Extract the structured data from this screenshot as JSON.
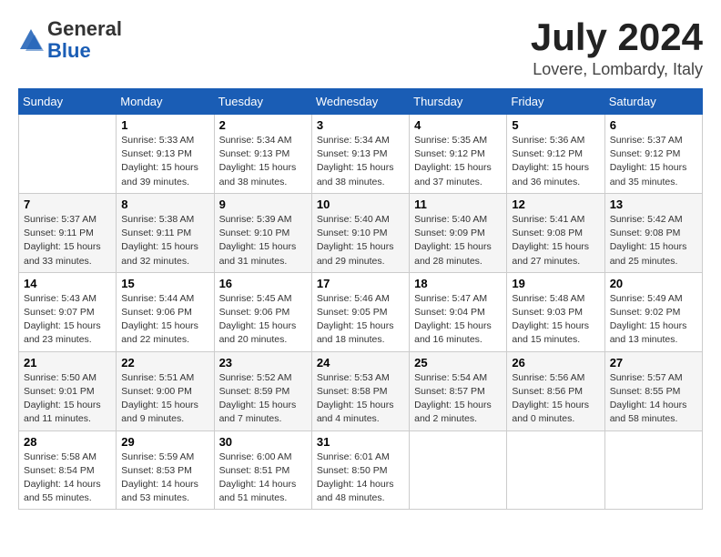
{
  "header": {
    "logo": {
      "line1": "General",
      "line2": "Blue"
    },
    "title": "July 2024",
    "location": "Lovere, Lombardy, Italy"
  },
  "weekdays": [
    "Sunday",
    "Monday",
    "Tuesday",
    "Wednesday",
    "Thursday",
    "Friday",
    "Saturday"
  ],
  "weeks": [
    [
      {
        "day": "",
        "detail": ""
      },
      {
        "day": "1",
        "detail": "Sunrise: 5:33 AM\nSunset: 9:13 PM\nDaylight: 15 hours\nand 39 minutes."
      },
      {
        "day": "2",
        "detail": "Sunrise: 5:34 AM\nSunset: 9:13 PM\nDaylight: 15 hours\nand 38 minutes."
      },
      {
        "day": "3",
        "detail": "Sunrise: 5:34 AM\nSunset: 9:13 PM\nDaylight: 15 hours\nand 38 minutes."
      },
      {
        "day": "4",
        "detail": "Sunrise: 5:35 AM\nSunset: 9:12 PM\nDaylight: 15 hours\nand 37 minutes."
      },
      {
        "day": "5",
        "detail": "Sunrise: 5:36 AM\nSunset: 9:12 PM\nDaylight: 15 hours\nand 36 minutes."
      },
      {
        "day": "6",
        "detail": "Sunrise: 5:37 AM\nSunset: 9:12 PM\nDaylight: 15 hours\nand 35 minutes."
      }
    ],
    [
      {
        "day": "7",
        "detail": "Sunrise: 5:37 AM\nSunset: 9:11 PM\nDaylight: 15 hours\nand 33 minutes."
      },
      {
        "day": "8",
        "detail": "Sunrise: 5:38 AM\nSunset: 9:11 PM\nDaylight: 15 hours\nand 32 minutes."
      },
      {
        "day": "9",
        "detail": "Sunrise: 5:39 AM\nSunset: 9:10 PM\nDaylight: 15 hours\nand 31 minutes."
      },
      {
        "day": "10",
        "detail": "Sunrise: 5:40 AM\nSunset: 9:10 PM\nDaylight: 15 hours\nand 29 minutes."
      },
      {
        "day": "11",
        "detail": "Sunrise: 5:40 AM\nSunset: 9:09 PM\nDaylight: 15 hours\nand 28 minutes."
      },
      {
        "day": "12",
        "detail": "Sunrise: 5:41 AM\nSunset: 9:08 PM\nDaylight: 15 hours\nand 27 minutes."
      },
      {
        "day": "13",
        "detail": "Sunrise: 5:42 AM\nSunset: 9:08 PM\nDaylight: 15 hours\nand 25 minutes."
      }
    ],
    [
      {
        "day": "14",
        "detail": "Sunrise: 5:43 AM\nSunset: 9:07 PM\nDaylight: 15 hours\nand 23 minutes."
      },
      {
        "day": "15",
        "detail": "Sunrise: 5:44 AM\nSunset: 9:06 PM\nDaylight: 15 hours\nand 22 minutes."
      },
      {
        "day": "16",
        "detail": "Sunrise: 5:45 AM\nSunset: 9:06 PM\nDaylight: 15 hours\nand 20 minutes."
      },
      {
        "day": "17",
        "detail": "Sunrise: 5:46 AM\nSunset: 9:05 PM\nDaylight: 15 hours\nand 18 minutes."
      },
      {
        "day": "18",
        "detail": "Sunrise: 5:47 AM\nSunset: 9:04 PM\nDaylight: 15 hours\nand 16 minutes."
      },
      {
        "day": "19",
        "detail": "Sunrise: 5:48 AM\nSunset: 9:03 PM\nDaylight: 15 hours\nand 15 minutes."
      },
      {
        "day": "20",
        "detail": "Sunrise: 5:49 AM\nSunset: 9:02 PM\nDaylight: 15 hours\nand 13 minutes."
      }
    ],
    [
      {
        "day": "21",
        "detail": "Sunrise: 5:50 AM\nSunset: 9:01 PM\nDaylight: 15 hours\nand 11 minutes."
      },
      {
        "day": "22",
        "detail": "Sunrise: 5:51 AM\nSunset: 9:00 PM\nDaylight: 15 hours\nand 9 minutes."
      },
      {
        "day": "23",
        "detail": "Sunrise: 5:52 AM\nSunset: 8:59 PM\nDaylight: 15 hours\nand 7 minutes."
      },
      {
        "day": "24",
        "detail": "Sunrise: 5:53 AM\nSunset: 8:58 PM\nDaylight: 15 hours\nand 4 minutes."
      },
      {
        "day": "25",
        "detail": "Sunrise: 5:54 AM\nSunset: 8:57 PM\nDaylight: 15 hours\nand 2 minutes."
      },
      {
        "day": "26",
        "detail": "Sunrise: 5:56 AM\nSunset: 8:56 PM\nDaylight: 15 hours\nand 0 minutes."
      },
      {
        "day": "27",
        "detail": "Sunrise: 5:57 AM\nSunset: 8:55 PM\nDaylight: 14 hours\nand 58 minutes."
      }
    ],
    [
      {
        "day": "28",
        "detail": "Sunrise: 5:58 AM\nSunset: 8:54 PM\nDaylight: 14 hours\nand 55 minutes."
      },
      {
        "day": "29",
        "detail": "Sunrise: 5:59 AM\nSunset: 8:53 PM\nDaylight: 14 hours\nand 53 minutes."
      },
      {
        "day": "30",
        "detail": "Sunrise: 6:00 AM\nSunset: 8:51 PM\nDaylight: 14 hours\nand 51 minutes."
      },
      {
        "day": "31",
        "detail": "Sunrise: 6:01 AM\nSunset: 8:50 PM\nDaylight: 14 hours\nand 48 minutes."
      },
      {
        "day": "",
        "detail": ""
      },
      {
        "day": "",
        "detail": ""
      },
      {
        "day": "",
        "detail": ""
      }
    ]
  ]
}
